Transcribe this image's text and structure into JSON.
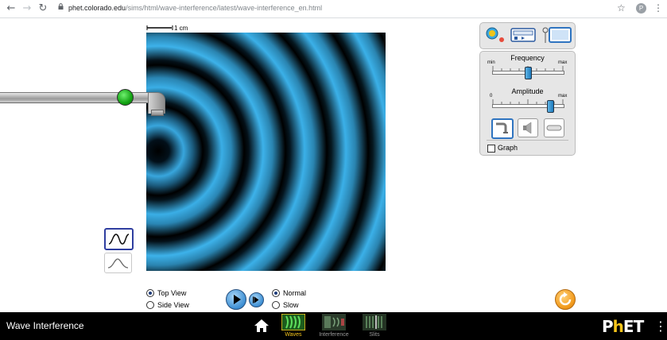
{
  "browser": {
    "url_host": "phet.colorado.edu",
    "url_path": "/sims/html/wave-interference/latest/wave-interference_en.html",
    "profile_initial": "P"
  },
  "scale": {
    "label": "1 cm"
  },
  "controls": {
    "frequency": {
      "label": "Frequency",
      "min_label": "min",
      "max_label": "max",
      "value_fraction": 0.5
    },
    "amplitude": {
      "label": "Amplitude",
      "min_label": "0",
      "max_label": "max",
      "value_fraction": 0.82
    },
    "graph_label": "Graph",
    "graph_checked": false
  },
  "view": {
    "top_view_label": "Top View",
    "side_view_label": "Side View",
    "selected": "Top View"
  },
  "speed": {
    "normal_label": "Normal",
    "slow_label": "Slow",
    "selected": "Normal"
  },
  "navbar": {
    "title": "Wave Interference",
    "screens": [
      {
        "label": "Waves",
        "selected": true
      },
      {
        "label": "Interference",
        "selected": false
      },
      {
        "label": "Slits",
        "selected": false
      }
    ],
    "brand": "PhET"
  },
  "colors": {
    "wave_light": "#3bb0e8",
    "wave_dark": "#000000",
    "faucet_button": "#13a313",
    "selected_screen_label": "#f6c51b",
    "navbar_bg": "#000000",
    "reset_button": "#f29b1e"
  }
}
